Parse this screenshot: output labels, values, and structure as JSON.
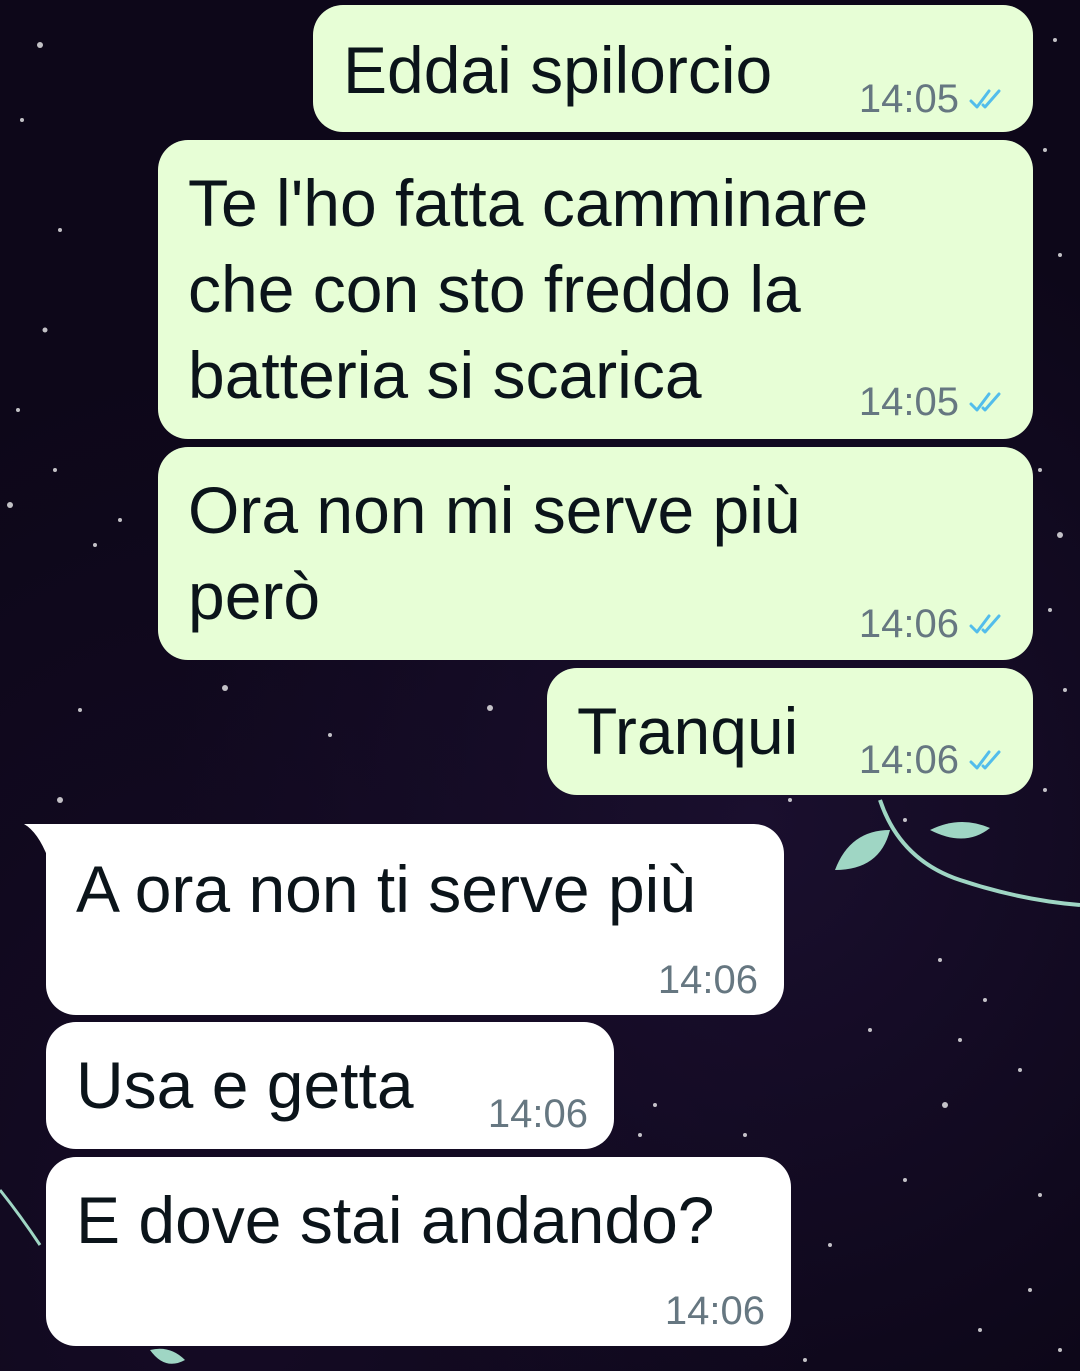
{
  "chat": {
    "messages": [
      {
        "id": "m1",
        "direction": "outgoing",
        "text": "Eddai spilorcio",
        "time": "14:05",
        "status": "read"
      },
      {
        "id": "m2",
        "direction": "outgoing",
        "text": "Te l'ho fatta camminare\nche con sto freddo la\nbatteria si scarica",
        "time": "14:05",
        "status": "read"
      },
      {
        "id": "m3",
        "direction": "outgoing",
        "text": "Ora non mi serve più\nperò",
        "time": "14:06",
        "status": "read"
      },
      {
        "id": "m4",
        "direction": "outgoing",
        "text": "Tranqui",
        "time": "14:06",
        "status": "read"
      },
      {
        "id": "m5",
        "direction": "incoming",
        "text": "A ora non ti serve più",
        "time": "14:06"
      },
      {
        "id": "m6",
        "direction": "incoming",
        "text": "Usa e getta",
        "time": "14:06"
      },
      {
        "id": "m7",
        "direction": "incoming",
        "text": "E dove stai andando?",
        "time": "14:06"
      }
    ]
  },
  "colors": {
    "outgoing_bubble": "#e7fed6",
    "incoming_bubble": "#ffffff",
    "read_ticks": "#53bdeb",
    "timestamp": "#667781",
    "wallpaper": "#0d0719"
  },
  "icons": {
    "read_receipt": "double-check-icon",
    "wallpaper_decoration": "vine-leaf-icon"
  }
}
